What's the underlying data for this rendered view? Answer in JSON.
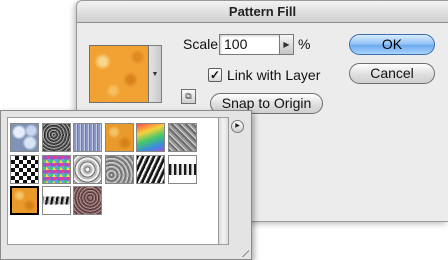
{
  "dialog": {
    "title": "Pattern Fill",
    "scale_label": "Scale:",
    "scale_value": "100",
    "scale_unit": "%",
    "link_with_layer_label": "Link with Layer",
    "link_with_layer_checked": true,
    "snap_to_origin_label": "Snap to Origin",
    "ok_label": "OK",
    "cancel_label": "Cancel"
  },
  "icons": {
    "check_mark": "✓",
    "dropdown_arrow": "▼",
    "stepper_arrow": "▶",
    "new_preset_icon": "⧉",
    "picker_menu_arrow": "▶"
  },
  "picker": {
    "selected_pattern_index": 12,
    "patterns": [
      {
        "texture": "bubbles"
      },
      {
        "texture": "granite"
      },
      {
        "texture": "stripes"
      },
      {
        "texture": "orange"
      },
      {
        "texture": "rainbow"
      },
      {
        "texture": "cloth"
      },
      {
        "texture": "checker"
      },
      {
        "texture": "mosaic"
      },
      {
        "texture": "scribble"
      },
      {
        "texture": "gravel"
      },
      {
        "texture": "black-white"
      },
      {
        "texture": "wave"
      },
      {
        "texture": "orange"
      },
      {
        "texture": "streak"
      },
      {
        "texture": "reddish-stone"
      }
    ]
  },
  "colors": {
    "ok_button_accent": "#6ba8ee",
    "selected_swatch": "#f1a233"
  }
}
